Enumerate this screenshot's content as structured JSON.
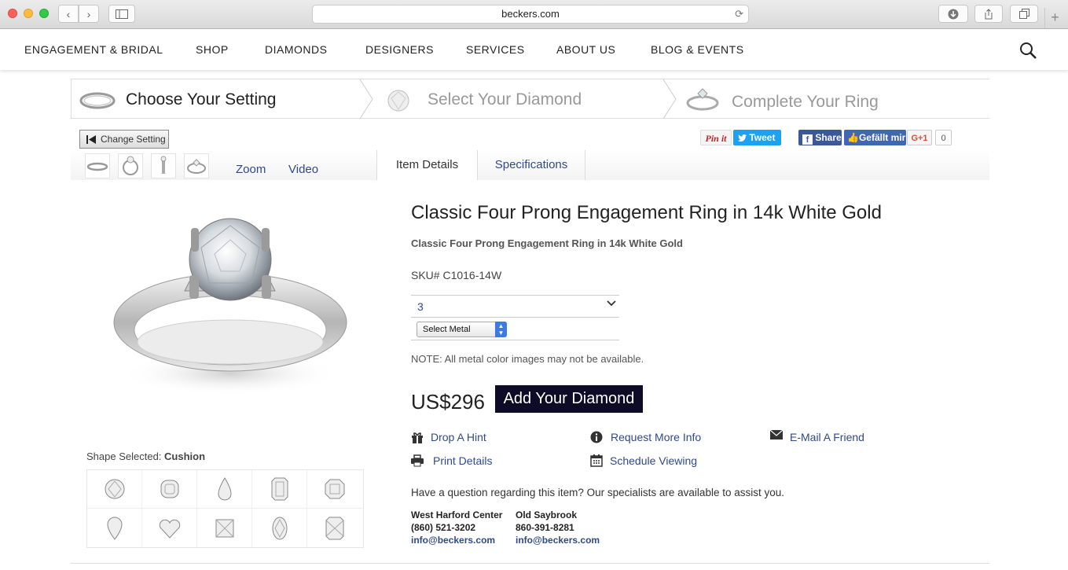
{
  "browser": {
    "url": "beckers.com"
  },
  "nav": {
    "items": [
      "ENGAGEMENT & BRIDAL",
      "SHOP",
      "DIAMONDS",
      "DESIGNERS",
      "SERVICES",
      "ABOUT US",
      "BLOG & EVENTS"
    ]
  },
  "steps": [
    {
      "label": "Choose Your Setting"
    },
    {
      "label": "Select Your Diamond"
    },
    {
      "label": "Complete Your Ring"
    }
  ],
  "toolbar": {
    "change_setting": "Change Setting",
    "pinit": "Pin it",
    "tweet": "Tweet",
    "share": "Share",
    "like": "Gefällt mir",
    "gplus": "G+1",
    "gplus_count": "0"
  },
  "media": {
    "zoom": "Zoom",
    "video": "Video"
  },
  "tabs": {
    "item_details": "Item Details",
    "specifications": "Specifications"
  },
  "product": {
    "title": "Classic Four Prong Engagement Ring in 14k White Gold",
    "subtitle": "Classic Four Prong Engagement Ring in 14k White Gold",
    "sku": "SKU# C1016-14W",
    "size_value": "3",
    "metal_placeholder": "Select Metal",
    "note": "NOTE: All metal color images may not be available.",
    "price": "US$296",
    "add_button": "Add Your Diamond"
  },
  "actions": {
    "drop_hint": "Drop A Hint",
    "request_info": "Request More Info",
    "email_friend": "E-Mail A Friend",
    "print_details": "Print Details",
    "schedule_viewing": "Schedule Viewing"
  },
  "contact": {
    "question": "Have a question regarding this item? Our specialists are available to assist you.",
    "stores": [
      {
        "name": "West Harford Center",
        "phone": "(860) 521-3202",
        "email": "info@beckers.com"
      },
      {
        "name": "Old Saybrook",
        "phone": "860-391-8281",
        "email": "info@beckers.com"
      }
    ]
  },
  "shapes": {
    "label": "Shape Selected:",
    "selected": "Cushion"
  },
  "colors": {
    "accent_link": "#2f4a8a",
    "add_button_bg": "#0d0b26",
    "tweet": "#1da1f2",
    "facebook": "#3b5998",
    "pinterest": "#cb2027"
  }
}
